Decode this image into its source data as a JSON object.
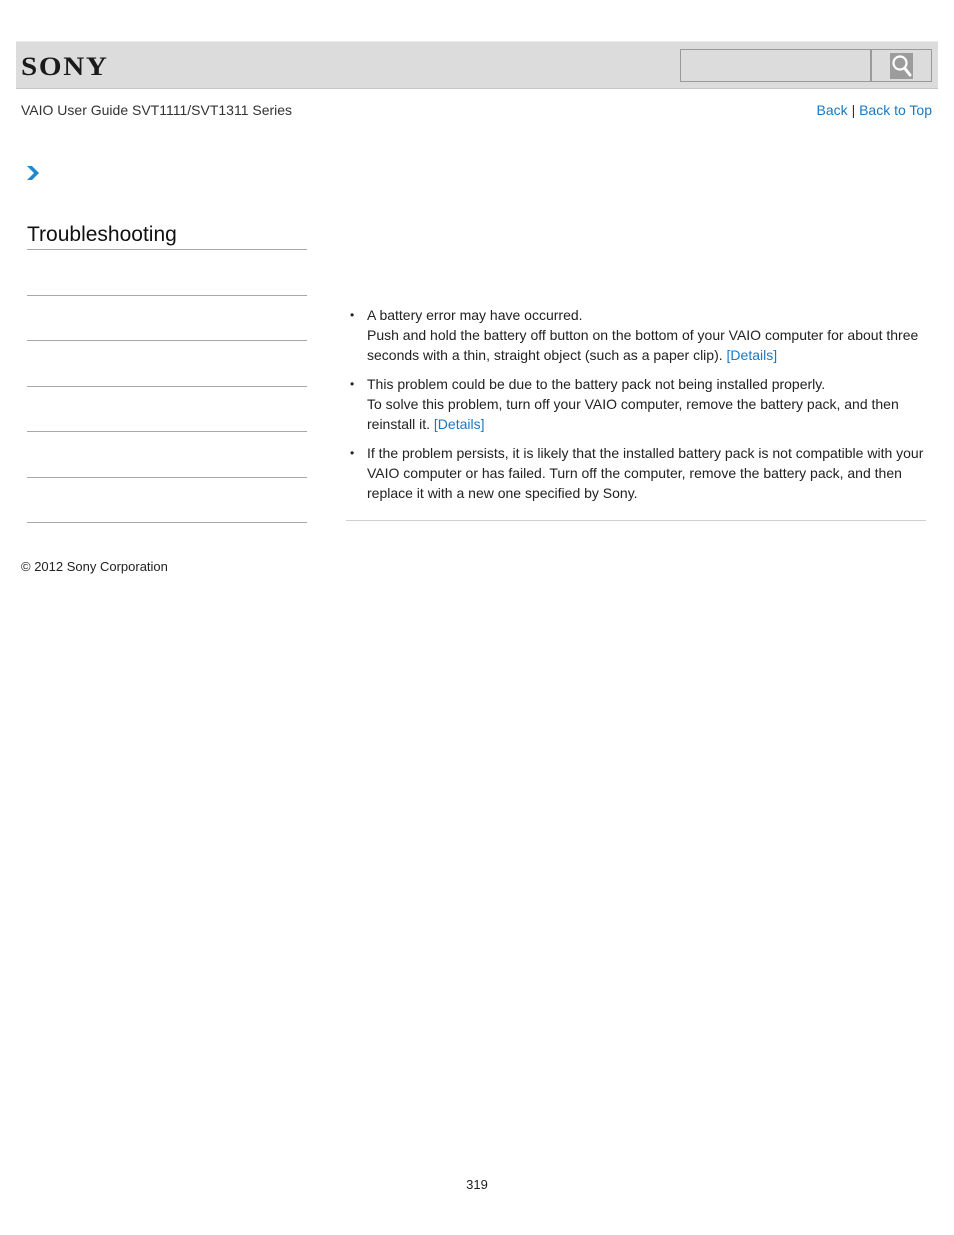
{
  "header": {
    "logo": "SONY",
    "search": {
      "placeholder": "",
      "value": ""
    },
    "search_button_icon": "search-icon"
  },
  "guide_title": "VAIO User Guide SVT1111/SVT1311 Series",
  "nav": {
    "back_label": "Back",
    "separator": "|",
    "back_to_top_label": "Back to Top"
  },
  "breadcrumb_icon": "chevron-right-icon",
  "sidebar": {
    "title": "Troubleshooting",
    "items": [
      "",
      "",
      "",
      "",
      "",
      ""
    ]
  },
  "content": {
    "items": [
      {
        "lead": "A battery error may have occurred.",
        "body": "Push and hold the battery off button on the bottom of your VAIO computer for about three seconds with a thin, straight object (such as a paper clip).",
        "link": "[Details]"
      },
      {
        "lead": "This problem could be due to the battery pack not being installed properly.",
        "body": "To solve this problem, turn off your VAIO computer, remove the battery pack, and then reinstall it.",
        "link": "[Details]"
      },
      {
        "lead": "If the problem persists, it is likely that the installed battery pack is not compatible with your VAIO computer or has failed. Turn off the computer, remove the battery pack, and then replace it with a new one specified by Sony.",
        "body": "",
        "link": ""
      }
    ]
  },
  "footer": {
    "copyright": "© 2012 Sony Corporation",
    "page_number": "319"
  },
  "colors": {
    "link": "#1a78c2",
    "header_bg": "#dcdcdc",
    "chevron": "#1e88d0"
  }
}
